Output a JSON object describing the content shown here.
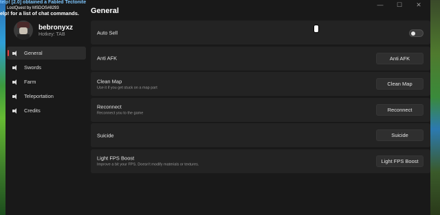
{
  "chat": {
    "line1": "telp! [2.0] obtained a Fabled Tectonite",
    "line2": "LostQuest by MSDOS#8293",
    "line3": "elp! for a list of chat commands."
  },
  "window": {
    "minimize": "—",
    "maximize": "☐",
    "close": "✕"
  },
  "profile": {
    "username": "bebronyxz",
    "hotkey": "Hotkey: TAB"
  },
  "nav": [
    {
      "label": "General",
      "active": true
    },
    {
      "label": "Swords"
    },
    {
      "label": "Farm"
    },
    {
      "label": "Teleportation"
    },
    {
      "label": "Credits"
    }
  ],
  "main": {
    "title": "General",
    "rows": [
      {
        "label": "Auto Sell",
        "desc": "",
        "control": "toggle",
        "toggle_on": false
      },
      {
        "label": "Anti AFK",
        "desc": "",
        "control": "button",
        "button": "Anti AFK"
      },
      {
        "label": "Clean Map",
        "desc": "Use it if you get stuck on a map part",
        "control": "button",
        "button": "Clean Map"
      },
      {
        "label": "Reconnect",
        "desc": "Reconnect you to the game",
        "control": "button",
        "button": "Reconnect"
      },
      {
        "label": "Suicide",
        "desc": "",
        "control": "button",
        "button": "Suicide"
      },
      {
        "label": "Light FPS Boost",
        "desc": "Improve a bit your FPS. Doesn't modify materials or textures.",
        "control": "button",
        "button": "Light FPS Boost"
      }
    ]
  },
  "colors": {
    "accent": "#e04040",
    "panel": "#191919",
    "row": "#232323"
  }
}
